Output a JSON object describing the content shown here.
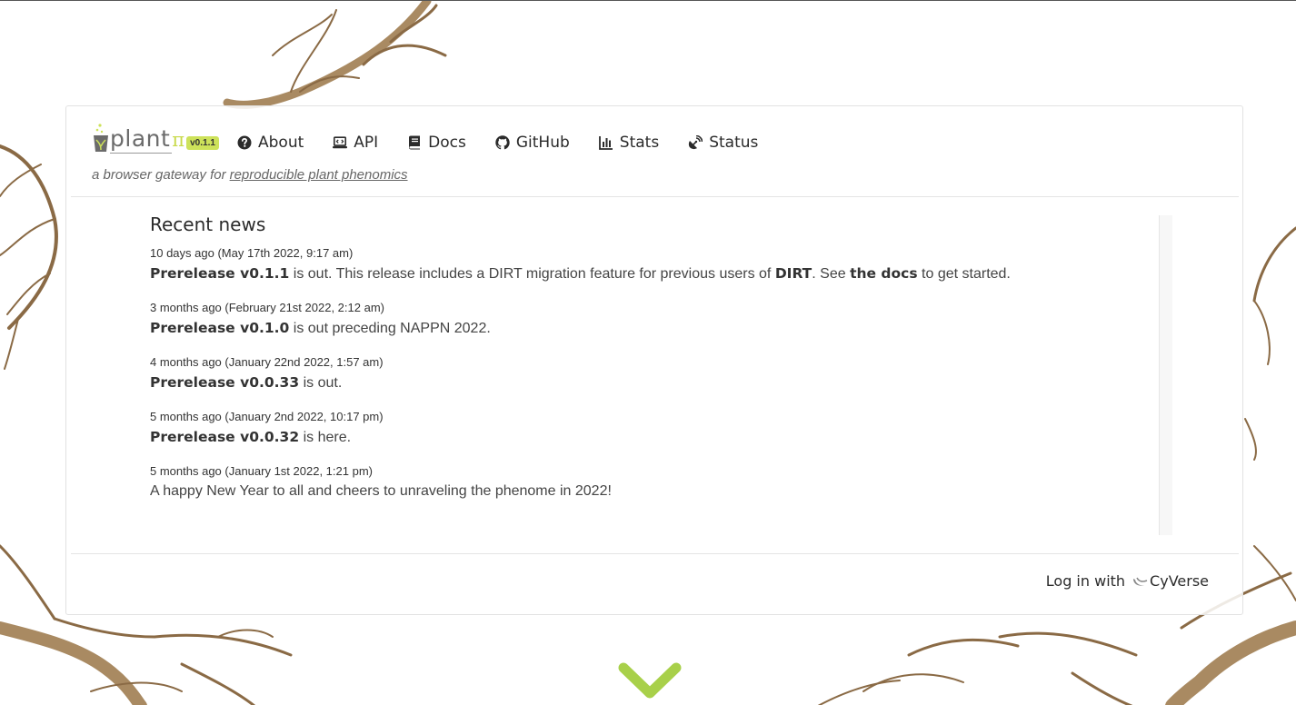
{
  "brand": {
    "name": "plant",
    "pi": "π",
    "version": "v0.1.1",
    "tagline_prefix": "a browser gateway for",
    "tagline_link": "reproducible plant phenomics",
    "accent_color": "#cde25a"
  },
  "nav": {
    "items": [
      {
        "label": "About",
        "icon": "question-circle-icon"
      },
      {
        "label": "API",
        "icon": "code-laptop-icon"
      },
      {
        "label": "Docs",
        "icon": "book-icon"
      },
      {
        "label": "GitHub",
        "icon": "github-icon"
      },
      {
        "label": "Stats",
        "icon": "bar-chart-icon"
      },
      {
        "label": "Status",
        "icon": "satellite-dish-icon"
      }
    ]
  },
  "news": {
    "title": "Recent news",
    "items": [
      {
        "date": "10 days ago (May 17th 2022, 9:17 am)",
        "bold1": "Prerelease v0.1.1",
        "text1": " is out. This release includes a DIRT migration feature for previous users of ",
        "bold2": "DIRT",
        "text2": ". See ",
        "bold3": "the docs",
        "text3": " to get started."
      },
      {
        "date": "3 months ago (February 21st 2022, 2:12 am)",
        "bold1": "Prerelease v0.1.0",
        "text1": " is out preceding NAPPN 2022."
      },
      {
        "date": "4 months ago (January 22nd 2022, 1:57 am)",
        "bold1": "Prerelease v0.0.33",
        "text1": " is out."
      },
      {
        "date": "5 months ago (January 2nd 2022, 10:17 pm)",
        "bold1": "Prerelease v0.0.32",
        "text1": " is here."
      },
      {
        "date": "5 months ago (January 1st 2022, 1:21 pm)",
        "text1": "A happy New Year to all and cheers to unraveling the phenome in 2022!"
      }
    ]
  },
  "login": {
    "prefix": "Log in with",
    "provider": "CyVerse"
  },
  "scroll_down_icon": "chevron-down-icon"
}
